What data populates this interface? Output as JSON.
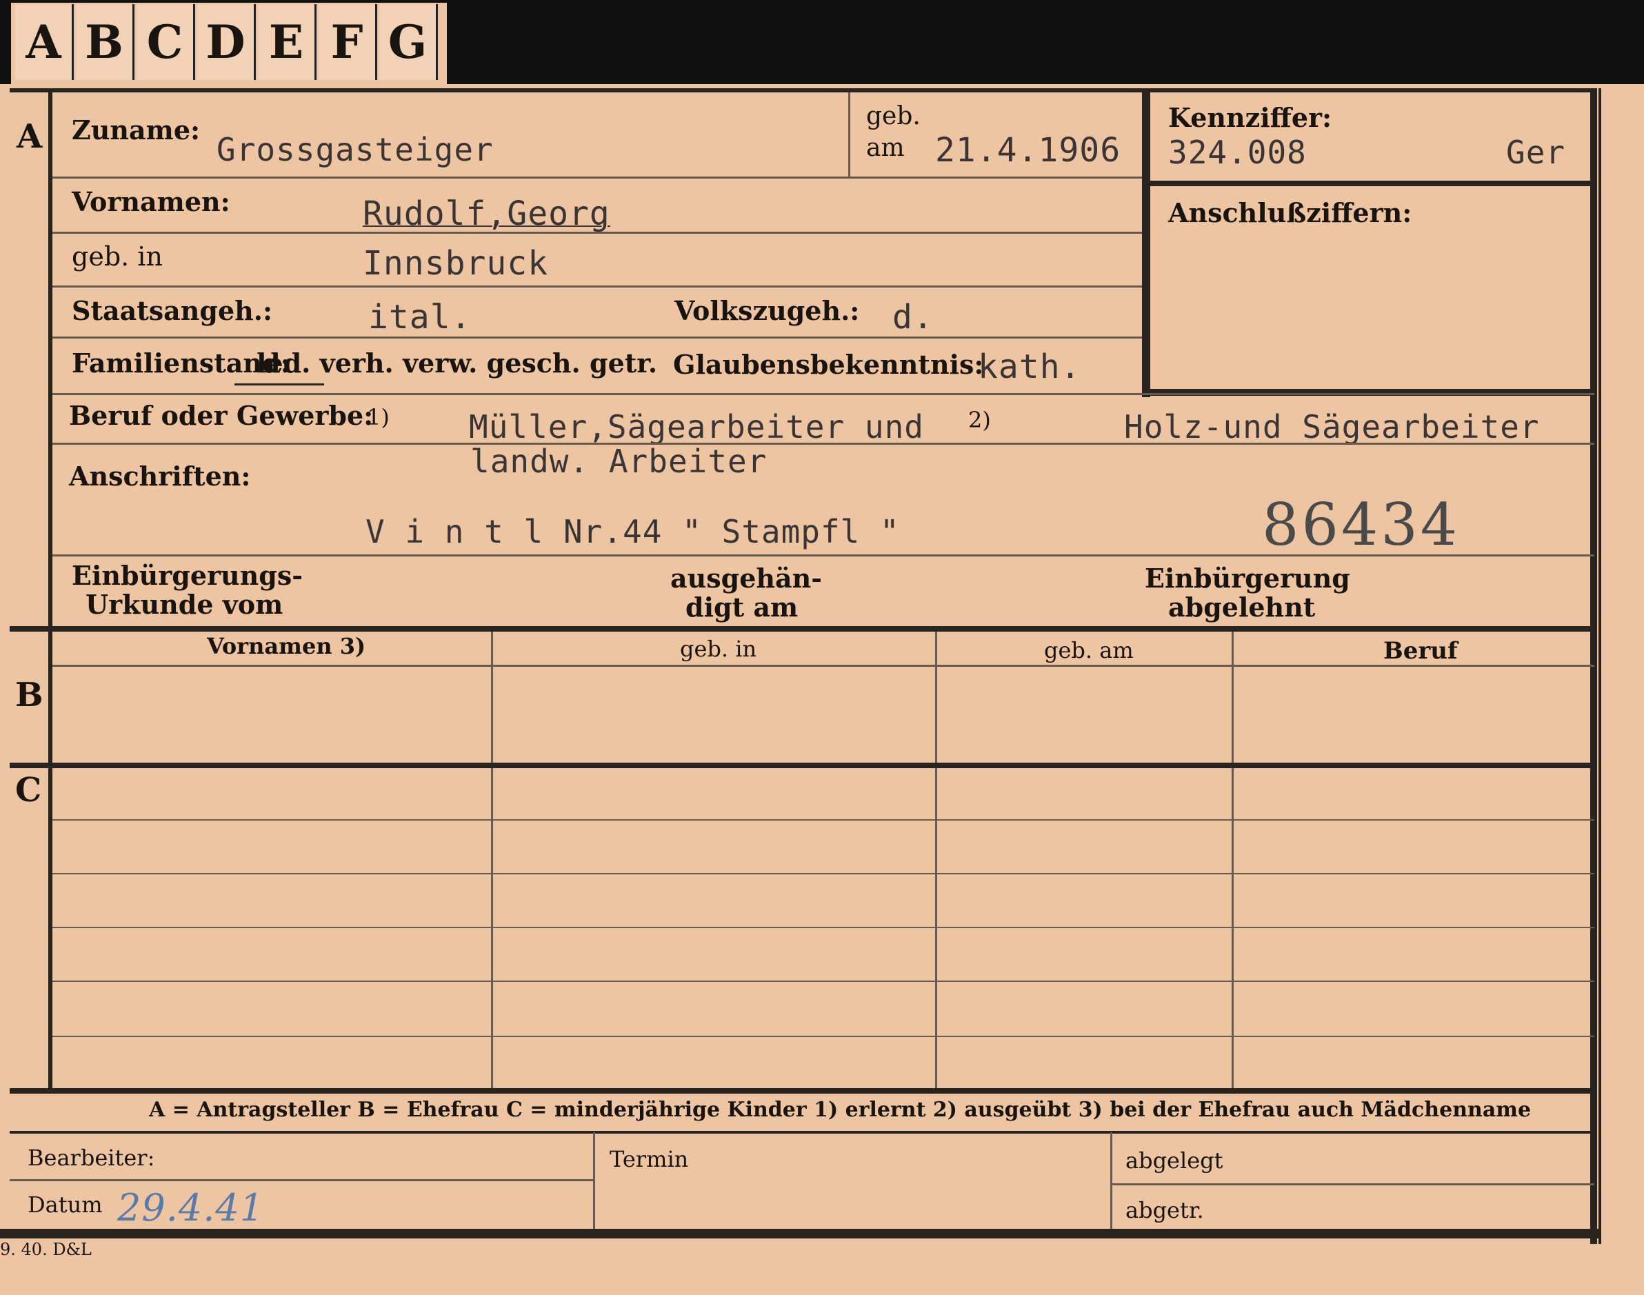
{
  "tabs": [
    "A",
    "B",
    "C",
    "D",
    "E",
    "F",
    "G"
  ],
  "section_markers": {
    "a": "A",
    "b": "B",
    "c": "C"
  },
  "applicant": {
    "surname_label": "Zuname:",
    "surname": "Grossgasteiger",
    "born_label_1": "geb.",
    "born_label_2": "am",
    "born_date": "21.4.1906",
    "reference_label": "Kennziffer:",
    "reference_number": "324.008",
    "reference_suffix": "Ger",
    "linked_numbers_label": "Anschlußziffern:",
    "first_names_label": "Vornamen:",
    "first_names": "Rudolf,Georg",
    "birthplace_label": "geb. in",
    "birthplace": "Innsbruck",
    "citizenship_label": "Staatsangeh.:",
    "citizenship": "ital.",
    "ethnicity_label": "Volkszugeh.:",
    "ethnicity": "d.",
    "marital_label": "Familienstand:",
    "marital_options": "led. verh. verw. gesch. getr.",
    "religion_label": "Glaubensbekenntnis:",
    "religion": "kath.",
    "occupation_label": "Beruf oder Gewerbe:",
    "note1": "1)",
    "occupation_learned": "Müller,Sägearbeiter und",
    "occupation_learned_line2": "landw. Arbeiter",
    "note2": "2)",
    "occupation_practised": "Holz-und Sägearbeiter",
    "addresses_label": "Anschriften:",
    "address": "V i n t l Nr.44 \" Stampfl \"",
    "stamp_number": "86434",
    "naturalization_doc_label_1": "Einbürgerungs-",
    "naturalization_doc_label_2": "Urkunde vom",
    "handed_out_label_1": "ausgehän-",
    "handed_out_label_2": "digt am",
    "naturalization_refused_label_1": "Einbürgerung",
    "naturalization_refused_label_2": "abgelehnt"
  },
  "table": {
    "headers": [
      "Vornamen 3)",
      "geb. in",
      "geb. am",
      "Beruf"
    ]
  },
  "legend": "A = Antragsteller   B = Ehefrau   C = minderjährige Kinder   1) erlernt   2) ausgeübt   3) bei der Ehefrau auch Mädchenname",
  "footer": {
    "clerk_label": "Bearbeiter:",
    "date_label": "Datum",
    "date_value": "29.4.41",
    "deadline_label": "Termin",
    "filed_label": "abgelegt",
    "removed_label": "abgetr.",
    "print_code": "9. 40. D&L"
  },
  "colors": {
    "paper": "#edc5a3",
    "ink": "#1a1410",
    "typewriter": "#3a3434",
    "pencil_blue": "#5a7aa8",
    "stamp": "#4a4a4a"
  }
}
